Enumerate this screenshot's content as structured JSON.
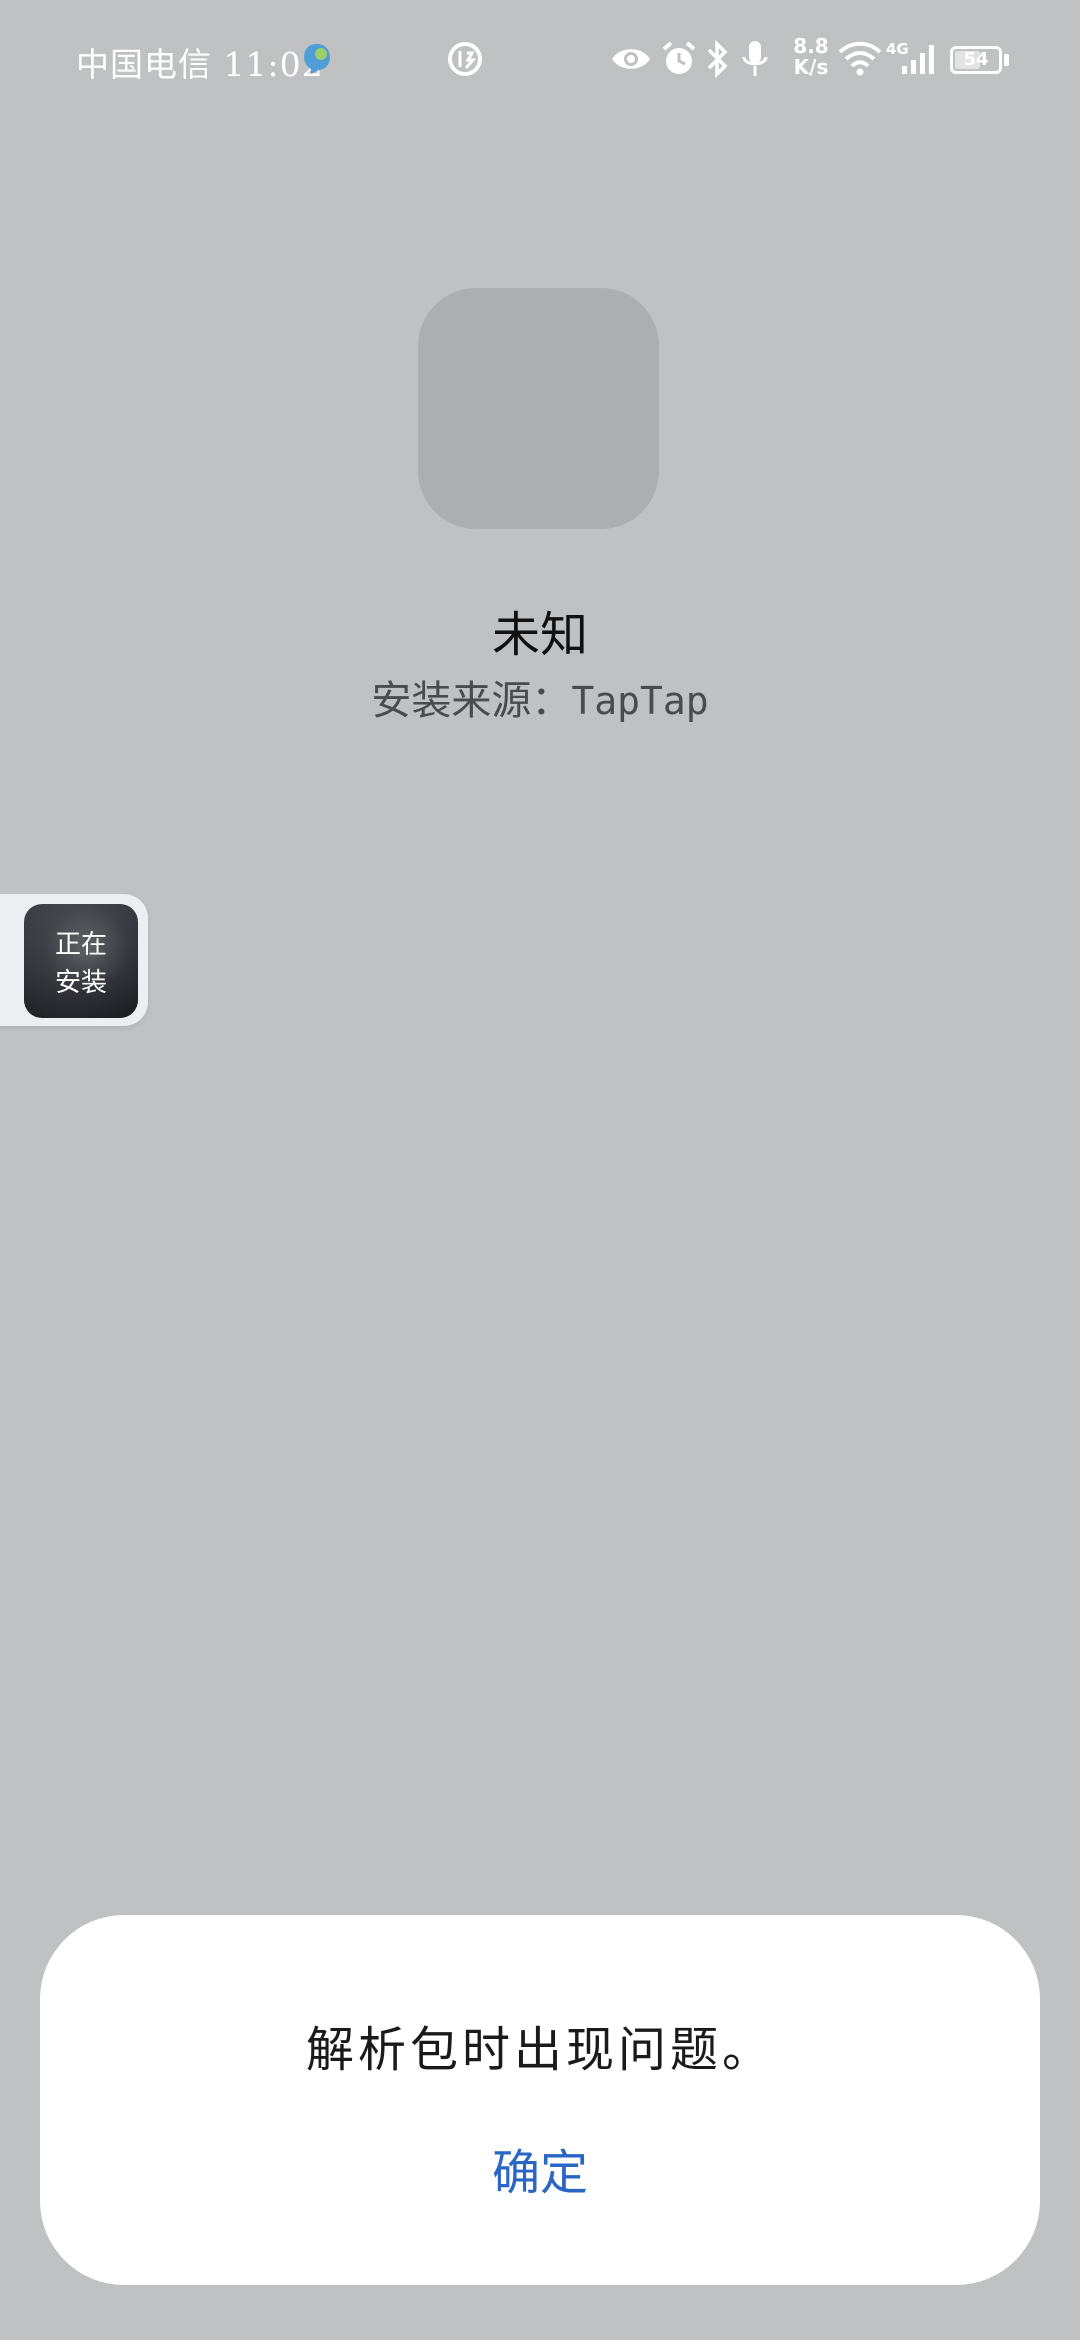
{
  "status_bar": {
    "carrier": "中国电信",
    "time": "11:02",
    "speed_value": "8.8",
    "speed_unit": "K/s",
    "network_type": "4G",
    "battery_percent": "54",
    "icons": [
      "assistant-icon",
      "data-saver-icon",
      "eye-icon",
      "alarm-icon",
      "bluetooth-icon",
      "microphone-icon",
      "wifi-icon",
      "signal-icon",
      "battery-icon"
    ]
  },
  "app": {
    "name": "未知",
    "source_label": "安装来源：",
    "source_value": "TapTap"
  },
  "floating_installer": {
    "line1": "正在",
    "line2": "安装"
  },
  "dialog": {
    "message": "解析包时出现问题。",
    "ok_label": "确定",
    "ok_color": "#2a66c6"
  },
  "colors": {
    "background": "#c0c1c3",
    "dialog": "#ffffff"
  }
}
